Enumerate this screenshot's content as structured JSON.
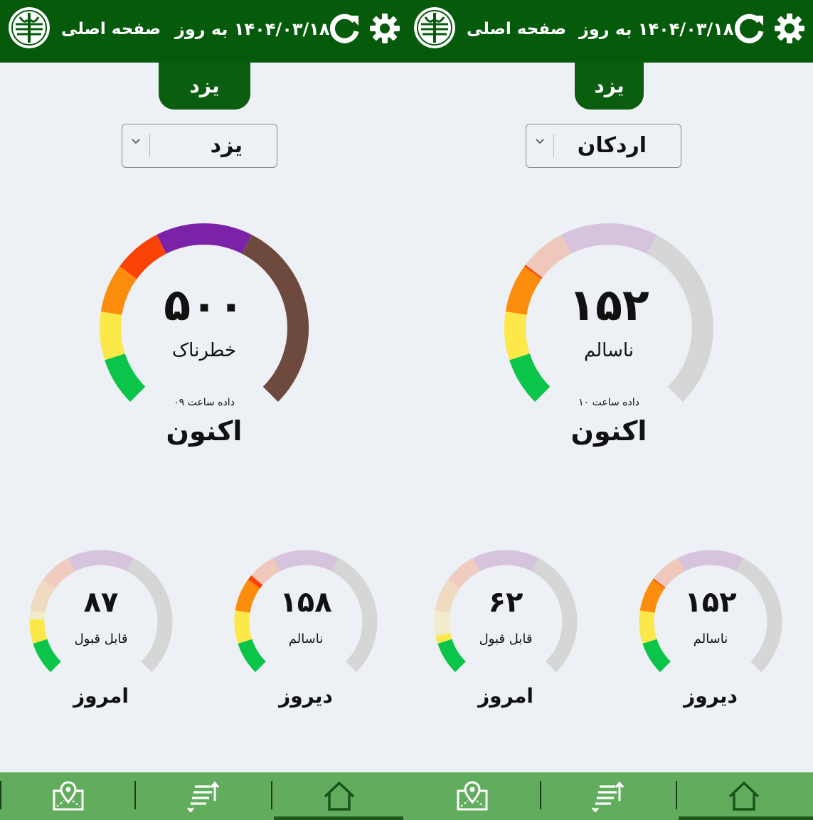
{
  "colors": {
    "header_green": "#055a0b",
    "tab_green": "#0b5e10",
    "bottom_green": "#62ad5d",
    "aqi_good": "#0bc44a",
    "aqi_moderate": "#fde84a",
    "aqi_sensitive": "#fb8c0c",
    "aqi_unhealthy": "#fb4308",
    "aqi_very_unhealthy": "#7c22a8",
    "aqi_hazardous": "#6e4a3e",
    "track": "#d6d6d6"
  },
  "panels": [
    {
      "header": {
        "logo_icon": "environment-logo-icon",
        "home_label": "صفحه اصلی",
        "update_label": "۱۴۰۴/۰۳/۱۸ به روز",
        "refresh_icon": "refresh-icon",
        "settings_icon": "gear-icon"
      },
      "province_tab": "یزد",
      "city_select": {
        "value": "یزد",
        "icon": "chevron-down-icon"
      },
      "now": {
        "aqi": 500,
        "aqi_text": "۵۰۰",
        "category": "خطرناک",
        "hour_label": "داده ساعت ۰۹",
        "label": "اکنون"
      },
      "yesterday": {
        "aqi": 158,
        "aqi_text": "۱۵۸",
        "category": "ناسالم",
        "label": "دیروز"
      },
      "today": {
        "aqi": 87,
        "aqi_text": "۸۷",
        "category": "قابل قبول",
        "label": "امروز"
      },
      "nav": {
        "map_icon": "map-pin-icon",
        "list_icon": "sort-list-icon",
        "home_icon": "home-icon"
      }
    },
    {
      "header": {
        "logo_icon": "environment-logo-icon",
        "home_label": "صفحه اصلی",
        "update_label": "۱۴۰۴/۰۳/۱۸ به روز",
        "refresh_icon": "refresh-icon",
        "settings_icon": "gear-icon"
      },
      "province_tab": "یزد",
      "city_select": {
        "value": "اردکان",
        "icon": "chevron-down-icon"
      },
      "now": {
        "aqi": 152,
        "aqi_text": "۱۵۲",
        "category": "ناسالم",
        "hour_label": "داده ساعت ۱۰",
        "label": "اکنون"
      },
      "yesterday": {
        "aqi": 152,
        "aqi_text": "۱۵۲",
        "category": "ناسالم",
        "label": "دیروز"
      },
      "today": {
        "aqi": 62,
        "aqi_text": "۶۲",
        "category": "قابل قبول",
        "label": "امروز"
      },
      "nav": {
        "map_icon": "map-pin-icon",
        "list_icon": "sort-list-icon",
        "home_icon": "home-icon"
      }
    }
  ]
}
